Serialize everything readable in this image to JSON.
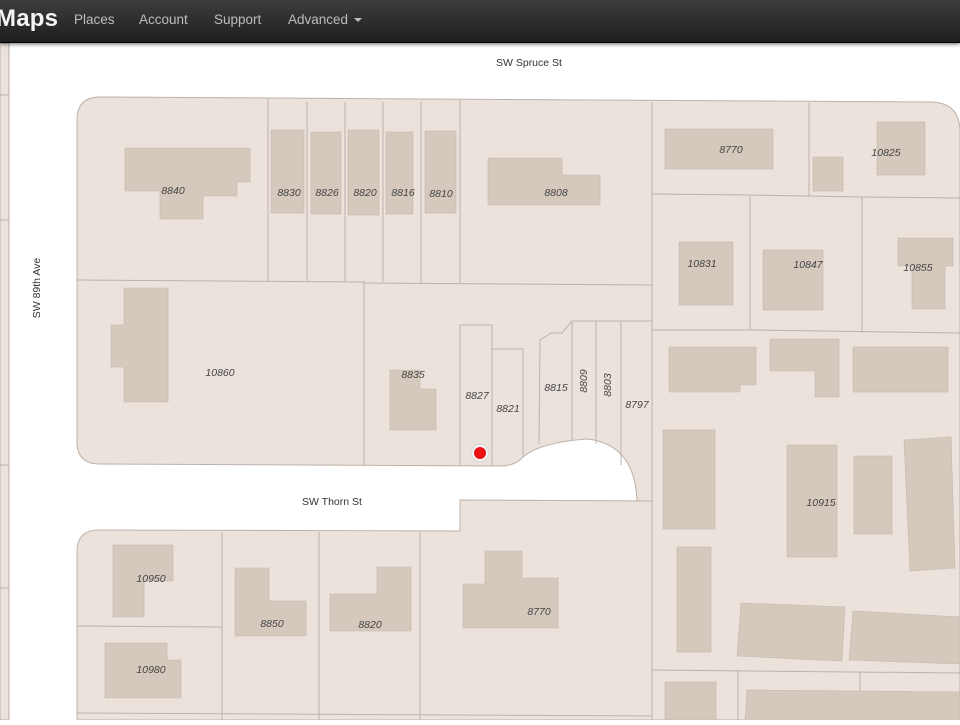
{
  "navbar": {
    "brand": "Maps",
    "items": [
      {
        "label": "Places"
      },
      {
        "label": "Account"
      },
      {
        "label": "Support"
      },
      {
        "label": "Advanced"
      }
    ]
  },
  "map": {
    "colors": {
      "parcel_fill": "#ebe2dc",
      "parcel_stroke": "#bdb2aa",
      "building_fill": "#d5c9bd",
      "street": "#ffffff",
      "marker": "#ee1111"
    },
    "streets": {
      "north": "SW Spruce St",
      "west": "SW 89th Ave",
      "south": "SW Thorn St"
    },
    "parcels": {
      "p8840": "8840",
      "p8830": "8830",
      "p8826": "8826",
      "p8820n": "8820",
      "p8816": "8816",
      "p8810": "8810",
      "p8808": "8808",
      "p8770n": "8770",
      "p10825": "10825",
      "p10831": "10831",
      "p10847": "10847",
      "p10855": "10855",
      "p10860": "10860",
      "p8835": "8835",
      "p8827": "8827",
      "p8821": "8821",
      "p8815": "8815",
      "p8809": "8809",
      "p8803": "8803",
      "p8797": "8797",
      "p10915": "10915",
      "p10950": "10950",
      "p10980": "10980",
      "p8850": "8850",
      "p8820s": "8820",
      "p8770s": "8770"
    }
  }
}
